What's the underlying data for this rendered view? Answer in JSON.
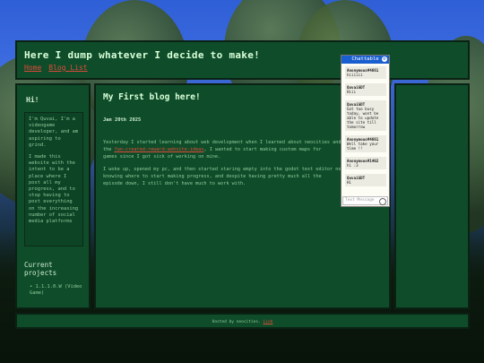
{
  "header": {
    "title": "Here I dump whatever I decide to make!",
    "nav": [
      "Home",
      "Blog List"
    ]
  },
  "sidebar": {
    "greeting": "Hi!",
    "about": [
      "I'm Quvai, I'm a videogame developer, and am aspiring to grind.",
      "I made this website with the intent to be a place where I post all my progress, and to stop having to post everything on the increasing number of social media platforms"
    ],
    "current_projects_title": "Current projects",
    "projects": [
      "1.1.1.0.W (Video Game)"
    ]
  },
  "post": {
    "title": "My First blog here!",
    "date": "Jan 20th 2025",
    "paragraph1_line1": "Yesterday I started learning about web development when I learned about neocities and",
    "paragraph1_line2_pre": "the",
    "paragraph1_link": "fan-created-reward-website-ideas",
    "paragraph1_line2_post": ", I wanted to start making custom maps for",
    "paragraph1_line3": "games since I got sick of working on mine.",
    "paragraph2_line1": "I woke up, opened my pc, and then started staring empty into the godot text editor not",
    "paragraph2_line2": "knowing where to start making progress, and despite having pretty much all the",
    "paragraph2_line3": "episode down, I still don't have much to work with."
  },
  "chat": {
    "title": "Chattable",
    "messages": [
      {
        "who": "Anonymous#4661",
        "text": "hiiiiii"
      },
      {
        "who": "QuvaiGDT",
        "text": "Hiii"
      },
      {
        "who": "QuvaiGDT",
        "text": "Got too busy today, wont be able to update the site till tomorrow"
      },
      {
        "who": "Anonymous#4661",
        "text": "Well take your time !!"
      },
      {
        "who": "Anonymous#1402",
        "text": "hi :3"
      },
      {
        "who": "QuvaiGDT",
        "text": "Hi"
      }
    ],
    "placeholder": "Text Message"
  },
  "footer": {
    "text": "Hosted by neocities.",
    "link": "Link"
  },
  "colors": {
    "panel": "#0f4d2a",
    "link": "#e04a3a",
    "chat_header": "#1a5fcf"
  }
}
